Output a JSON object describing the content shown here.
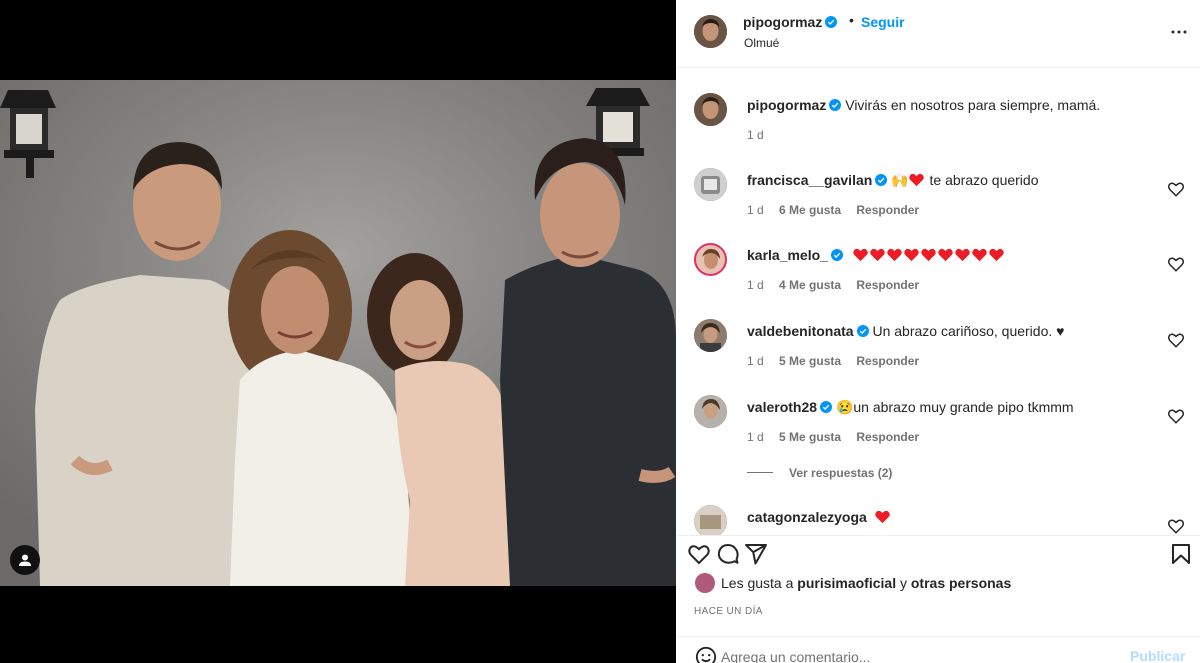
{
  "post": {
    "username": "pipogormaz",
    "follow_label": "Seguir",
    "dot": "•",
    "location": "Olmué"
  },
  "caption": {
    "username": "pipogormaz",
    "text": "Vivirás en nosotros para siempre, mamá.",
    "time": "1 d"
  },
  "comments": [
    {
      "username": "francisca__gavilan",
      "emoji": "🙌",
      "hearts": 1,
      "text": "te abrazo querido",
      "time": "1 d",
      "likes": "6 Me gusta",
      "reply": "Responder",
      "avatar_color": "#9a9a9a"
    },
    {
      "username": "karla_melo_",
      "emoji": "",
      "hearts": 9,
      "text": "",
      "time": "1 d",
      "likes": "4 Me gusta",
      "reply": "Responder",
      "avatar_color": "#d3a38a"
    },
    {
      "username": "valdebenitonata",
      "emoji": "",
      "hearts": 0,
      "text": "Un abrazo cariñoso, querido. ♥",
      "time": "1 d",
      "likes": "5 Me gusta",
      "reply": "Responder",
      "avatar_color": "#5a5048"
    },
    {
      "username": "valeroth28",
      "emoji": "😢",
      "hearts": 0,
      "text": "un abrazo muy grande pipo tkmmm",
      "time": "1 d",
      "likes": "5 Me gusta",
      "reply": "Responder",
      "avatar_color": "#8f8a86"
    },
    {
      "username": "catagonzalezyoga",
      "emoji": "",
      "hearts": 1,
      "text": "",
      "time": "",
      "likes": "",
      "reply": "",
      "avatar_color": "#b9a99a"
    }
  ],
  "view_replies": "Ver respuestas (2)",
  "likes": {
    "prefix": "Les gusta a ",
    "user": "purisimaoficial",
    "mid": " y ",
    "others": "otras personas"
  },
  "timestamp": "HACE UN DÍA",
  "add_comment": {
    "placeholder": "Agrega un comentario...",
    "post_label": "Publicar"
  },
  "colors": {
    "accent": "#0095f6",
    "heart": "#ed1c24",
    "verified": "#0095f6",
    "post_disabled": "#b3dbff"
  },
  "icons": [
    "more-icon",
    "heart-icon",
    "comment-icon",
    "share-icon",
    "bookmark-icon",
    "smile-icon",
    "user-tag-icon",
    "verified-icon"
  ]
}
